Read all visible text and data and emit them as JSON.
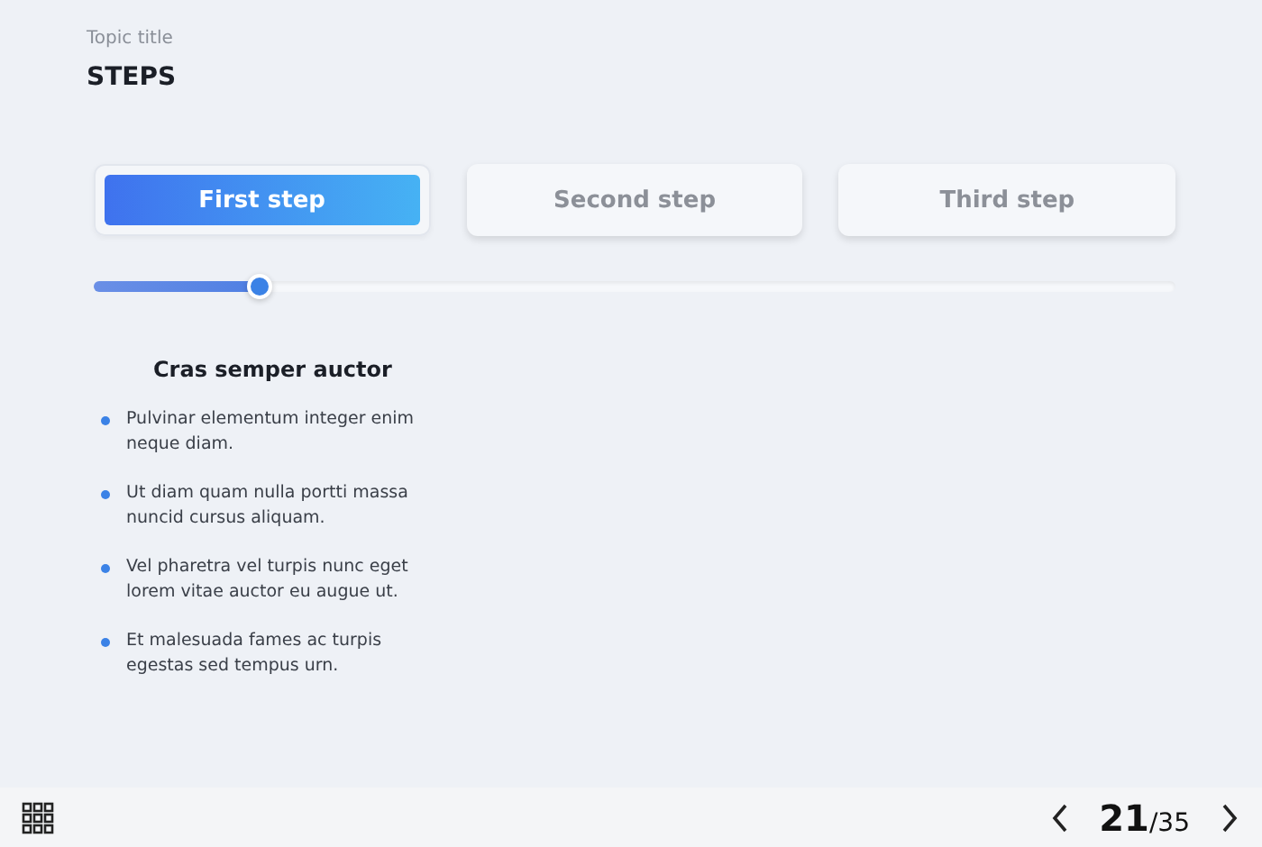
{
  "header": {
    "topic": "Topic title",
    "title": "STEPS"
  },
  "steps": [
    {
      "label": "First step",
      "selected": true
    },
    {
      "label": "Second step",
      "selected": false
    },
    {
      "label": "Third step",
      "selected": false
    }
  ],
  "progress": {
    "level": 0.153
  },
  "content": {
    "heading": "Cras semper auctor",
    "bullets": [
      "Pulvinar elementum integer enim neque diam.",
      "Ut diam quam nulla portti massa nuncid cursus aliquam.",
      "Vel pharetra vel turpis nunc eget lorem vitae auctor eu augue ut.",
      "Et malesuada fames ac turpis egestas sed tempus urn."
    ]
  },
  "footer": {
    "current": "21",
    "total": "/35"
  }
}
